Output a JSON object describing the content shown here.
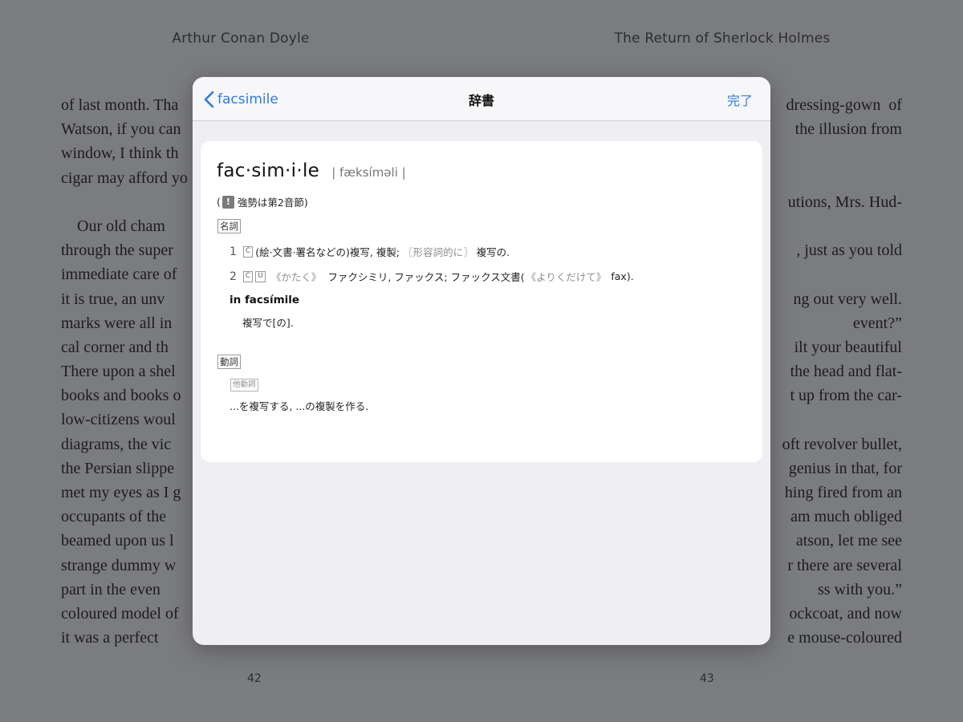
{
  "book": {
    "author": "Arthur Conan Doyle",
    "title": "The Return of Sherlock Holmes",
    "left_page_number": "42",
    "right_page_number": "43",
    "left_lines": [
      "of last month. Tha",
      "Watson, if you can",
      "window, I think th",
      "cigar may afford yo",
      "",
      "    Our old cham",
      "through the super",
      "immediate care of",
      "it is true, an unv",
      "marks were all in",
      "cal corner and th",
      "There upon a shel",
      "books and books o",
      "low-citizens woul",
      "diagrams, the vic",
      "the Persian slippe",
      "met my eyes as I g",
      "occupants of the",
      "beamed upon us l",
      "strange dummy w",
      "part in the even",
      "coloured model of",
      "it was a perfect"
    ],
    "right_lines": [
      "dressing-gown  of",
      "the illusion from",
      "",
      "",
      "utions, Mrs. Hud-",
      "",
      ", just as you told",
      "",
      "ng out very well.",
      "event?”",
      "ilt your beautiful",
      "the head and flat-",
      "t up from the car-",
      "",
      "oft revolver bullet,",
      "genius in that, for",
      "hing fired from an",
      "am much obliged",
      "atson, let me see",
      "r there are several",
      "ss with you.”",
      "ockcoat, and now",
      "e mouse-coloured"
    ]
  },
  "dictionary": {
    "back_label": "facsimile",
    "nav_title": "辞書",
    "done_label": "完了",
    "headword": "fac·sim·i·le",
    "pronunciation": "| fæksímǝli |",
    "stress_prefix": "(",
    "stress_badge": "!",
    "stress_note": "強勢は第2音節)",
    "pos_noun": "名詞",
    "senses": [
      {
        "num": "1",
        "labels": [
          "C"
        ],
        "text": "(絵·文書·署名などの)複写, 複製;",
        "note": "〖形容詞的に〗",
        "text_after": "複写の."
      },
      {
        "num": "2",
        "labels": [
          "C",
          "U"
        ],
        "note": "《かたく》",
        "text": "ファクシミリ, ファックス; ファックス文書(",
        "note2": "《よりくだけて》",
        "text_after": "fax)."
      }
    ],
    "phrase": "in facsímile",
    "phrase_meaning": "複写で[の].",
    "pos_verb": "動詞",
    "verb_type": "他動詞",
    "verb_meaning": "...を複写する, ...の複製を作る."
  },
  "colors": {
    "accent": "#2f7dd6",
    "backdrop": "#7b7c7e"
  }
}
